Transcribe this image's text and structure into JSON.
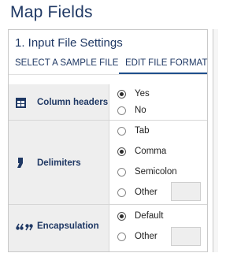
{
  "page_title": "Map Fields",
  "section": {
    "title": "1. Input File Settings",
    "tabs": [
      {
        "label": "SELECT A SAMPLE FILE",
        "active": false
      },
      {
        "label": "EDIT FILE FORMAT",
        "active": true
      }
    ]
  },
  "settings": {
    "column_headers": {
      "label": "Column headers",
      "icon": "table-icon",
      "options": [
        "Yes",
        "No"
      ],
      "selected": "Yes"
    },
    "delimiters": {
      "label": "Delimiters",
      "icon": "comma-icon",
      "options": [
        "Tab",
        "Comma",
        "Semicolon",
        "Other"
      ],
      "selected": "Comma",
      "other_value": ""
    },
    "encapsulation": {
      "label": "Encapsulation",
      "icon": "quotes-icon",
      "options": [
        "Default",
        "Other"
      ],
      "selected": "Default",
      "other_value": ""
    }
  },
  "colors": {
    "accent": "#1f3864",
    "label_bg": "#eeeeee"
  }
}
